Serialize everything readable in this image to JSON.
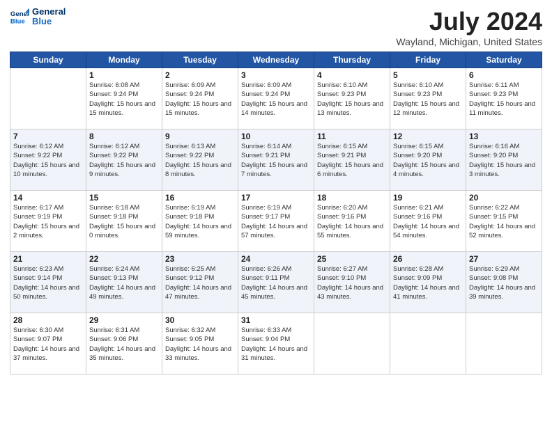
{
  "header": {
    "logo_line1": "General",
    "logo_line2": "Blue",
    "month": "July 2024",
    "location": "Wayland, Michigan, United States"
  },
  "weekdays": [
    "Sunday",
    "Monday",
    "Tuesday",
    "Wednesday",
    "Thursday",
    "Friday",
    "Saturday"
  ],
  "weeks": [
    [
      {
        "day": "",
        "sunrise": "",
        "sunset": "",
        "daylight": ""
      },
      {
        "day": "1",
        "sunrise": "6:08 AM",
        "sunset": "9:24 PM",
        "daylight": "15 hours and 15 minutes."
      },
      {
        "day": "2",
        "sunrise": "6:09 AM",
        "sunset": "9:24 PM",
        "daylight": "15 hours and 15 minutes."
      },
      {
        "day": "3",
        "sunrise": "6:09 AM",
        "sunset": "9:24 PM",
        "daylight": "15 hours and 14 minutes."
      },
      {
        "day": "4",
        "sunrise": "6:10 AM",
        "sunset": "9:23 PM",
        "daylight": "15 hours and 13 minutes."
      },
      {
        "day": "5",
        "sunrise": "6:10 AM",
        "sunset": "9:23 PM",
        "daylight": "15 hours and 12 minutes."
      },
      {
        "day": "6",
        "sunrise": "6:11 AM",
        "sunset": "9:23 PM",
        "daylight": "15 hours and 11 minutes."
      }
    ],
    [
      {
        "day": "7",
        "sunrise": "6:12 AM",
        "sunset": "9:22 PM",
        "daylight": "15 hours and 10 minutes."
      },
      {
        "day": "8",
        "sunrise": "6:12 AM",
        "sunset": "9:22 PM",
        "daylight": "15 hours and 9 minutes."
      },
      {
        "day": "9",
        "sunrise": "6:13 AM",
        "sunset": "9:22 PM",
        "daylight": "15 hours and 8 minutes."
      },
      {
        "day": "10",
        "sunrise": "6:14 AM",
        "sunset": "9:21 PM",
        "daylight": "15 hours and 7 minutes."
      },
      {
        "day": "11",
        "sunrise": "6:15 AM",
        "sunset": "9:21 PM",
        "daylight": "15 hours and 6 minutes."
      },
      {
        "day": "12",
        "sunrise": "6:15 AM",
        "sunset": "9:20 PM",
        "daylight": "15 hours and 4 minutes."
      },
      {
        "day": "13",
        "sunrise": "6:16 AM",
        "sunset": "9:20 PM",
        "daylight": "15 hours and 3 minutes."
      }
    ],
    [
      {
        "day": "14",
        "sunrise": "6:17 AM",
        "sunset": "9:19 PM",
        "daylight": "15 hours and 2 minutes."
      },
      {
        "day": "15",
        "sunrise": "6:18 AM",
        "sunset": "9:18 PM",
        "daylight": "15 hours and 0 minutes."
      },
      {
        "day": "16",
        "sunrise": "6:19 AM",
        "sunset": "9:18 PM",
        "daylight": "14 hours and 59 minutes."
      },
      {
        "day": "17",
        "sunrise": "6:19 AM",
        "sunset": "9:17 PM",
        "daylight": "14 hours and 57 minutes."
      },
      {
        "day": "18",
        "sunrise": "6:20 AM",
        "sunset": "9:16 PM",
        "daylight": "14 hours and 55 minutes."
      },
      {
        "day": "19",
        "sunrise": "6:21 AM",
        "sunset": "9:16 PM",
        "daylight": "14 hours and 54 minutes."
      },
      {
        "day": "20",
        "sunrise": "6:22 AM",
        "sunset": "9:15 PM",
        "daylight": "14 hours and 52 minutes."
      }
    ],
    [
      {
        "day": "21",
        "sunrise": "6:23 AM",
        "sunset": "9:14 PM",
        "daylight": "14 hours and 50 minutes."
      },
      {
        "day": "22",
        "sunrise": "6:24 AM",
        "sunset": "9:13 PM",
        "daylight": "14 hours and 49 minutes."
      },
      {
        "day": "23",
        "sunrise": "6:25 AM",
        "sunset": "9:12 PM",
        "daylight": "14 hours and 47 minutes."
      },
      {
        "day": "24",
        "sunrise": "6:26 AM",
        "sunset": "9:11 PM",
        "daylight": "14 hours and 45 minutes."
      },
      {
        "day": "25",
        "sunrise": "6:27 AM",
        "sunset": "9:10 PM",
        "daylight": "14 hours and 43 minutes."
      },
      {
        "day": "26",
        "sunrise": "6:28 AM",
        "sunset": "9:09 PM",
        "daylight": "14 hours and 41 minutes."
      },
      {
        "day": "27",
        "sunrise": "6:29 AM",
        "sunset": "9:08 PM",
        "daylight": "14 hours and 39 minutes."
      }
    ],
    [
      {
        "day": "28",
        "sunrise": "6:30 AM",
        "sunset": "9:07 PM",
        "daylight": "14 hours and 37 minutes."
      },
      {
        "day": "29",
        "sunrise": "6:31 AM",
        "sunset": "9:06 PM",
        "daylight": "14 hours and 35 minutes."
      },
      {
        "day": "30",
        "sunrise": "6:32 AM",
        "sunset": "9:05 PM",
        "daylight": "14 hours and 33 minutes."
      },
      {
        "day": "31",
        "sunrise": "6:33 AM",
        "sunset": "9:04 PM",
        "daylight": "14 hours and 31 minutes."
      },
      {
        "day": "",
        "sunrise": "",
        "sunset": "",
        "daylight": ""
      },
      {
        "day": "",
        "sunrise": "",
        "sunset": "",
        "daylight": ""
      },
      {
        "day": "",
        "sunrise": "",
        "sunset": "",
        "daylight": ""
      }
    ]
  ],
  "labels": {
    "sunrise_prefix": "Sunrise: ",
    "sunset_prefix": "Sunset: ",
    "daylight_prefix": "Daylight: "
  }
}
